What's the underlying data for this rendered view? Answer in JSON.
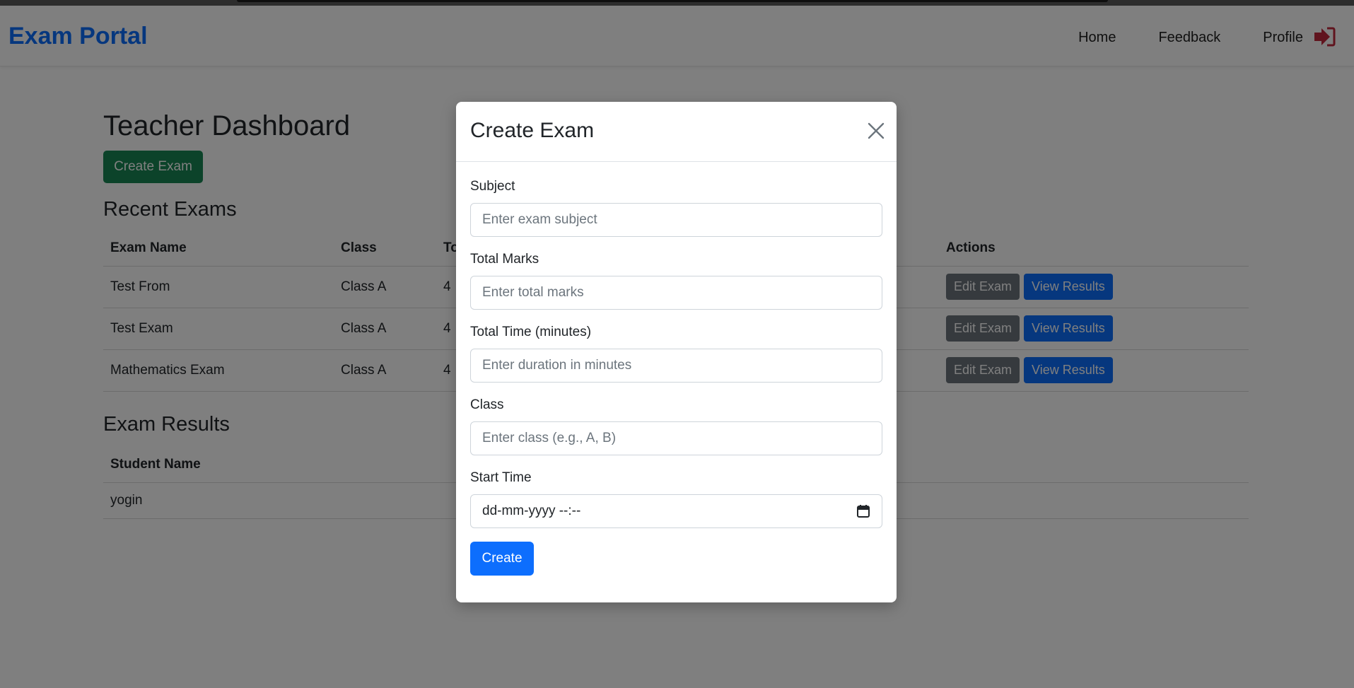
{
  "navbar": {
    "brand": "Exam Portal",
    "links": [
      "Home",
      "Feedback",
      "Profile"
    ],
    "logout_icon": "sign-out-icon",
    "logout_color": "#c0283c"
  },
  "dashboard": {
    "title": "Teacher Dashboard",
    "create_button": "Create Exam",
    "recent_title": "Recent Exams",
    "recent_headers": [
      "Exam Name",
      "Class",
      "To",
      "Actions"
    ],
    "recent_rows": [
      {
        "name": "Test From",
        "class": "Class A",
        "total": "4"
      },
      {
        "name": "Test Exam",
        "class": "Class A",
        "total": "4"
      },
      {
        "name": "Mathematics Exam",
        "class": "Class A",
        "total": "4"
      }
    ],
    "edit_label": "Edit Exam",
    "view_label": "View Results",
    "results_title": "Exam Results",
    "results_headers": [
      "Student Name"
    ],
    "results_rows": [
      {
        "student": "yogin"
      }
    ]
  },
  "modal": {
    "title": "Create Exam",
    "fields": [
      {
        "label": "Subject",
        "placeholder": "Enter exam subject"
      },
      {
        "label": "Total Marks",
        "placeholder": "Enter total marks"
      },
      {
        "label": "Total Time (minutes)",
        "placeholder": "Enter duration in minutes"
      },
      {
        "label": "Class",
        "placeholder": "Enter class (e.g., A, B)"
      }
    ],
    "start_time_label": "Start Time",
    "start_time_value": "dd-mm-yyyy --:--",
    "submit_label": "Create"
  },
  "colors": {
    "brand": "#0d6efd",
    "success": "#198754",
    "secondary": "#6c757d",
    "primary": "#0d6efd"
  }
}
